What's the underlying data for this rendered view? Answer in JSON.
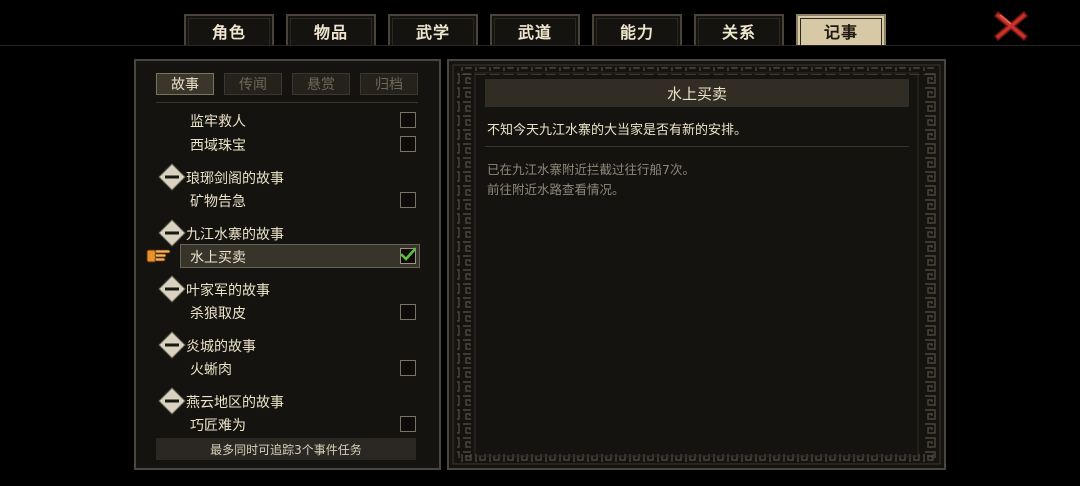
{
  "tabs": [
    {
      "label": "角色",
      "active": false
    },
    {
      "label": "物品",
      "active": false
    },
    {
      "label": "武学",
      "active": false
    },
    {
      "label": "武道",
      "active": false
    },
    {
      "label": "能力",
      "active": false
    },
    {
      "label": "关系",
      "active": false
    },
    {
      "label": "记事",
      "active": true
    }
  ],
  "close_icon": "red-x-icon",
  "subtabs": [
    {
      "label": "故事",
      "active": true
    },
    {
      "label": "传闻",
      "active": false
    },
    {
      "label": "悬赏",
      "active": false
    },
    {
      "label": "归档",
      "active": false
    }
  ],
  "quest_list": [
    {
      "type": "quest",
      "label": "监牢救人",
      "tracked": false
    },
    {
      "type": "quest",
      "label": "西域珠宝",
      "tracked": false
    },
    {
      "type": "group",
      "label": "琅琊剑阁的故事"
    },
    {
      "type": "quest",
      "label": "矿物告急",
      "tracked": false
    },
    {
      "type": "group",
      "label": "九江水寨的故事"
    },
    {
      "type": "quest",
      "label": "水上买卖",
      "tracked": true,
      "selected": true
    },
    {
      "type": "group",
      "label": "叶家军的故事"
    },
    {
      "type": "quest",
      "label": "杀狼取皮",
      "tracked": false
    },
    {
      "type": "group",
      "label": "炎城的故事"
    },
    {
      "type": "quest",
      "label": "火蜥肉",
      "tracked": false
    },
    {
      "type": "group",
      "label": "燕云地区的故事"
    },
    {
      "type": "quest",
      "label": "巧匠难为",
      "tracked": false
    }
  ],
  "footer_note": "最多同时可追踪3个事件任务",
  "detail": {
    "title": "水上买卖",
    "description": "不知今天九江水寨的大当家是否有新的安排。",
    "objectives": [
      "已在九江水寨附近拦截过往行船7次。",
      "前往附近水路查看情况。"
    ]
  },
  "colors": {
    "active_tab": "#d8c9a6",
    "close_red": "#c8322a",
    "check_green": "#5fbf3a",
    "pointer_orange": "#e8922a"
  }
}
